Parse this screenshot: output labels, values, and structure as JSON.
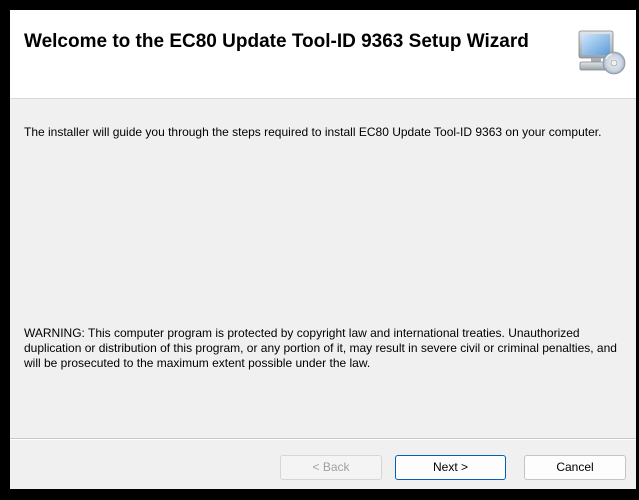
{
  "wizard": {
    "title": "Welcome to the EC80 Update Tool-ID 9363 Setup Wizard",
    "header_icon": "computer-cd-icon",
    "intro": "The installer will guide you through the steps required to install EC80 Update Tool-ID 9363 on your computer.",
    "warning": "WARNING: This computer program is protected by copyright law and international treaties. Unauthorized duplication or distribution of this program, or any portion of it, may result in severe civil or criminal penalties, and will be prosecuted to the maximum extent possible under the law."
  },
  "buttons": {
    "back_label": "< Back",
    "next_label": "Next >",
    "cancel_label": "Cancel"
  },
  "colors": {
    "header_bg": "#ffffff",
    "body_bg": "#f0f0f0",
    "accent": "#005fb8",
    "disabled_text": "#a0a0a0"
  }
}
